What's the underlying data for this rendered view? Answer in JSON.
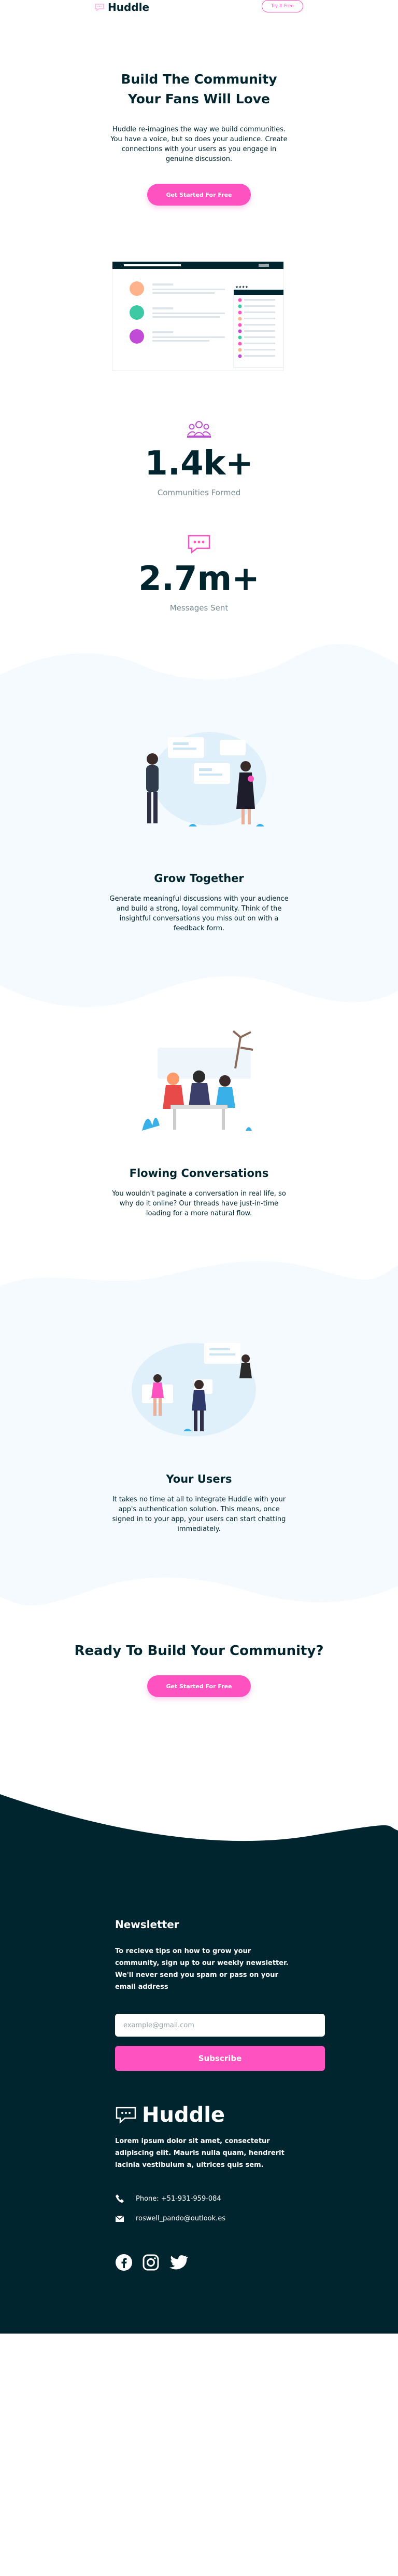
{
  "header": {
    "logo_text": "Huddle",
    "try_button": "Try It Free"
  },
  "hero": {
    "title": "Build The Community Your Fans Will Love",
    "description": "Huddle re-imagines the way we build communities. You have a voice, but so does your audience. Create connections with your users as you engage in genuine discussion.",
    "cta": "Get Started For Free"
  },
  "stats": [
    {
      "value": "1.4k+",
      "label": "Communities Formed",
      "icon": "users-icon"
    },
    {
      "value": "2.7m+",
      "label": "Messages Sent",
      "icon": "chat-bubble-icon"
    }
  ],
  "features": [
    {
      "title": "Grow Together",
      "text": "Generate meaningful discussions with your audience and build a strong, loyal community. Think of the insightful conversations you miss out on with a feedback form."
    },
    {
      "title": "Flowing Conversations",
      "text": "You wouldn't paginate a conversation in real life, so why do it online? Our threads have just-in-time loading for a more natural flow."
    },
    {
      "title": "Your Users",
      "text": "It takes no time at all to integrate Huddle with your app's authentication solution. This means, once signed in to your app, your users can start chatting immediately."
    }
  ],
  "final_cta": {
    "title": "Ready To Build Your Community?",
    "button": "Get Started For Free"
  },
  "footer": {
    "newsletter_title": "Newsletter",
    "newsletter_text": "To recieve tips on how to grow your community, sign up to our weekly newsletter. We'll never send you spam or pass on your email address",
    "email_placeholder": "example@gmail.com",
    "subscribe_button": "Subscribe",
    "logo_text": "Huddle",
    "about": "Lorem ipsum dolor sit amet, consectetur adipiscing elit. Mauris nulla quam, hendrerit lacinia vestibulum a, ultrices quis sem.",
    "phone": "Phone: +51-931-959-084",
    "email": "roswell_pando@outlook.es",
    "social": [
      "facebook-icon",
      "instagram-icon",
      "twitter-icon"
    ]
  },
  "colors": {
    "accent": "#ff52c1",
    "dark": "#00252e",
    "pale_blue": "#f5faff"
  }
}
